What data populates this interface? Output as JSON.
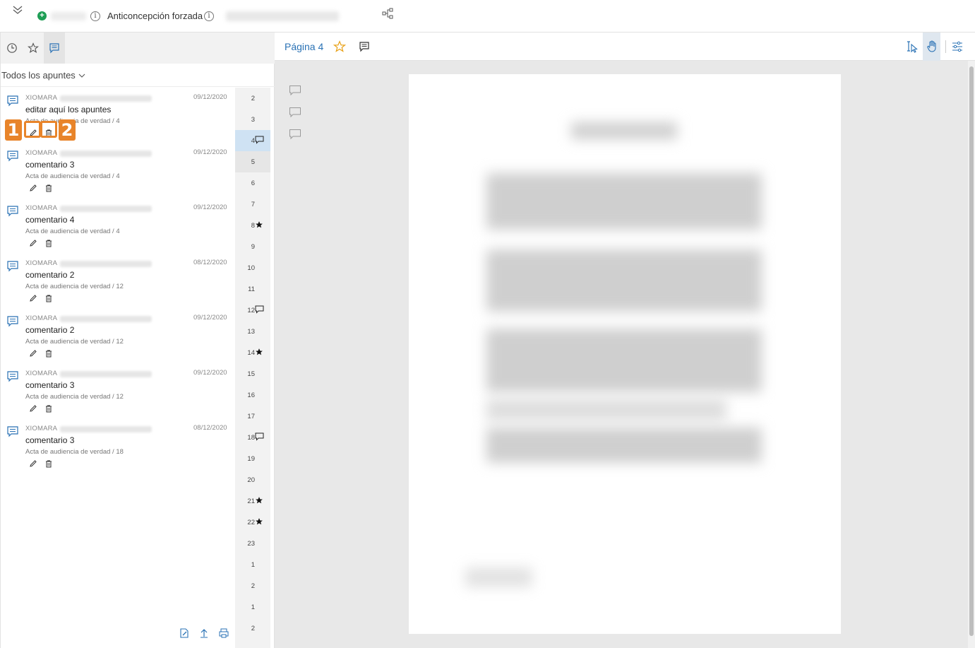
{
  "topbar": {
    "plus_glyph": "+",
    "info_glyph": "i",
    "title": "Anticoncepción forzada"
  },
  "sidebar": {
    "filter_label": "Todos los apuntes",
    "notes": [
      {
        "author": "XIOMARA",
        "date": "09/12/2020",
        "title": "editar aquí los apuntes",
        "source": "Acta de audiencia de verdad / 4"
      },
      {
        "author": "XIOMARA",
        "date": "09/12/2020",
        "title": "comentario 3",
        "source": "Acta de audiencia de verdad / 4"
      },
      {
        "author": "XIOMARA",
        "date": "09/12/2020",
        "title": "comentario 4",
        "source": "Acta de audiencia de verdad / 4"
      },
      {
        "author": "XIOMARA",
        "date": "08/12/2020",
        "title": "comentario 2",
        "source": "Acta de audiencia de verdad / 12"
      },
      {
        "author": "XIOMARA",
        "date": "09/12/2020",
        "title": "comentario 2",
        "source": "Acta de audiencia de verdad / 12"
      },
      {
        "author": "XIOMARA",
        "date": "09/12/2020",
        "title": "comentario 3",
        "source": "Acta de audiencia de verdad / 12"
      },
      {
        "author": "XIOMARA",
        "date": "08/12/2020",
        "title": "comentario 3",
        "source": "Acta de audiencia de verdad / 18"
      }
    ],
    "callouts": [
      "1",
      "2"
    ],
    "pages": [
      {
        "n": "2",
        "mark": ""
      },
      {
        "n": "3",
        "mark": ""
      },
      {
        "n": "4",
        "mark": "comment",
        "state": "active"
      },
      {
        "n": "5",
        "mark": "",
        "state": "light"
      },
      {
        "n": "6",
        "mark": ""
      },
      {
        "n": "7",
        "mark": ""
      },
      {
        "n": "8",
        "mark": "star"
      },
      {
        "n": "9",
        "mark": ""
      },
      {
        "n": "10",
        "mark": ""
      },
      {
        "n": "11",
        "mark": ""
      },
      {
        "n": "12",
        "mark": "comment"
      },
      {
        "n": "13",
        "mark": ""
      },
      {
        "n": "14",
        "mark": "star"
      },
      {
        "n": "15",
        "mark": ""
      },
      {
        "n": "16",
        "mark": ""
      },
      {
        "n": "17",
        "mark": ""
      },
      {
        "n": "18",
        "mark": "comment"
      },
      {
        "n": "19",
        "mark": ""
      },
      {
        "n": "20",
        "mark": ""
      },
      {
        "n": "21",
        "mark": "star"
      },
      {
        "n": "22",
        "mark": "star"
      },
      {
        "n": "23",
        "mark": ""
      },
      {
        "n": "1",
        "mark": ""
      },
      {
        "n": "2",
        "mark": ""
      },
      {
        "n": "1",
        "mark": ""
      },
      {
        "n": "2",
        "mark": ""
      },
      {
        "n": "",
        "mark": ""
      }
    ]
  },
  "viewer": {
    "page_label": "Página 4"
  },
  "colors": {
    "accent": "#2a72b5",
    "callout": "#e8842a",
    "add": "#1e9e55",
    "active_page": "#cfe2f3"
  }
}
